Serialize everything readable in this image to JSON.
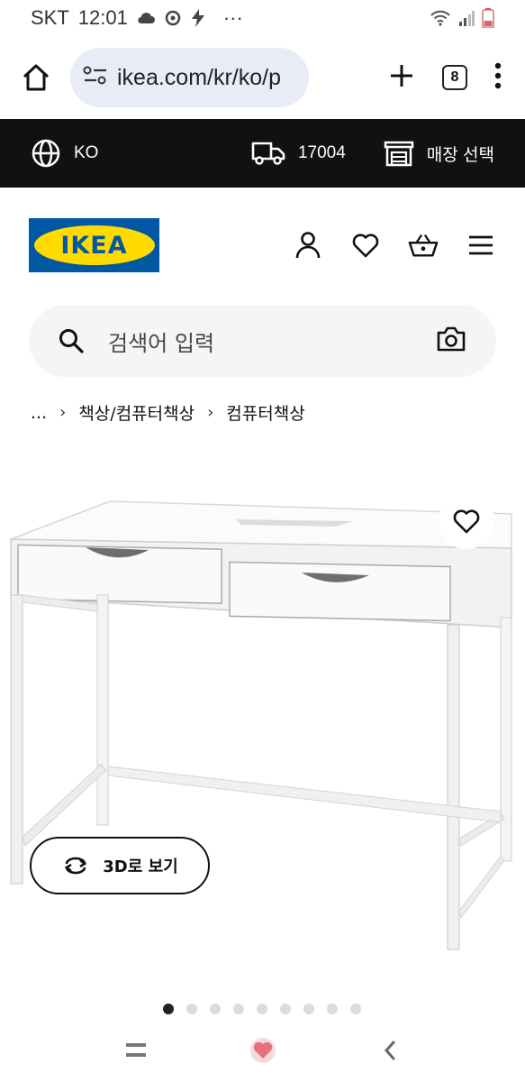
{
  "status_bar": {
    "carrier": "SKT",
    "time": "12:01",
    "more": "···"
  },
  "browser": {
    "url": "ikea.com/kr/ko/p",
    "tab_count": "8"
  },
  "utility": {
    "language": "KO",
    "postal_code": "17004",
    "store_label": "매장 선택"
  },
  "header": {
    "logo_text": "IKEA"
  },
  "search": {
    "placeholder": "검색어 입력"
  },
  "breadcrumb": {
    "ellipsis": "...",
    "items": [
      "책상/컴퓨터책상",
      "컴퓨터책상"
    ],
    "separator": "›"
  },
  "product": {
    "view_3d_label": "3D로 보기"
  },
  "carousel": {
    "total": 9,
    "active_index": 0
  },
  "colors": {
    "ikea_blue": "#0058a3",
    "ikea_yellow": "#ffdb00",
    "utility_bg": "#111111",
    "url_pill": "#e8ecf6"
  }
}
